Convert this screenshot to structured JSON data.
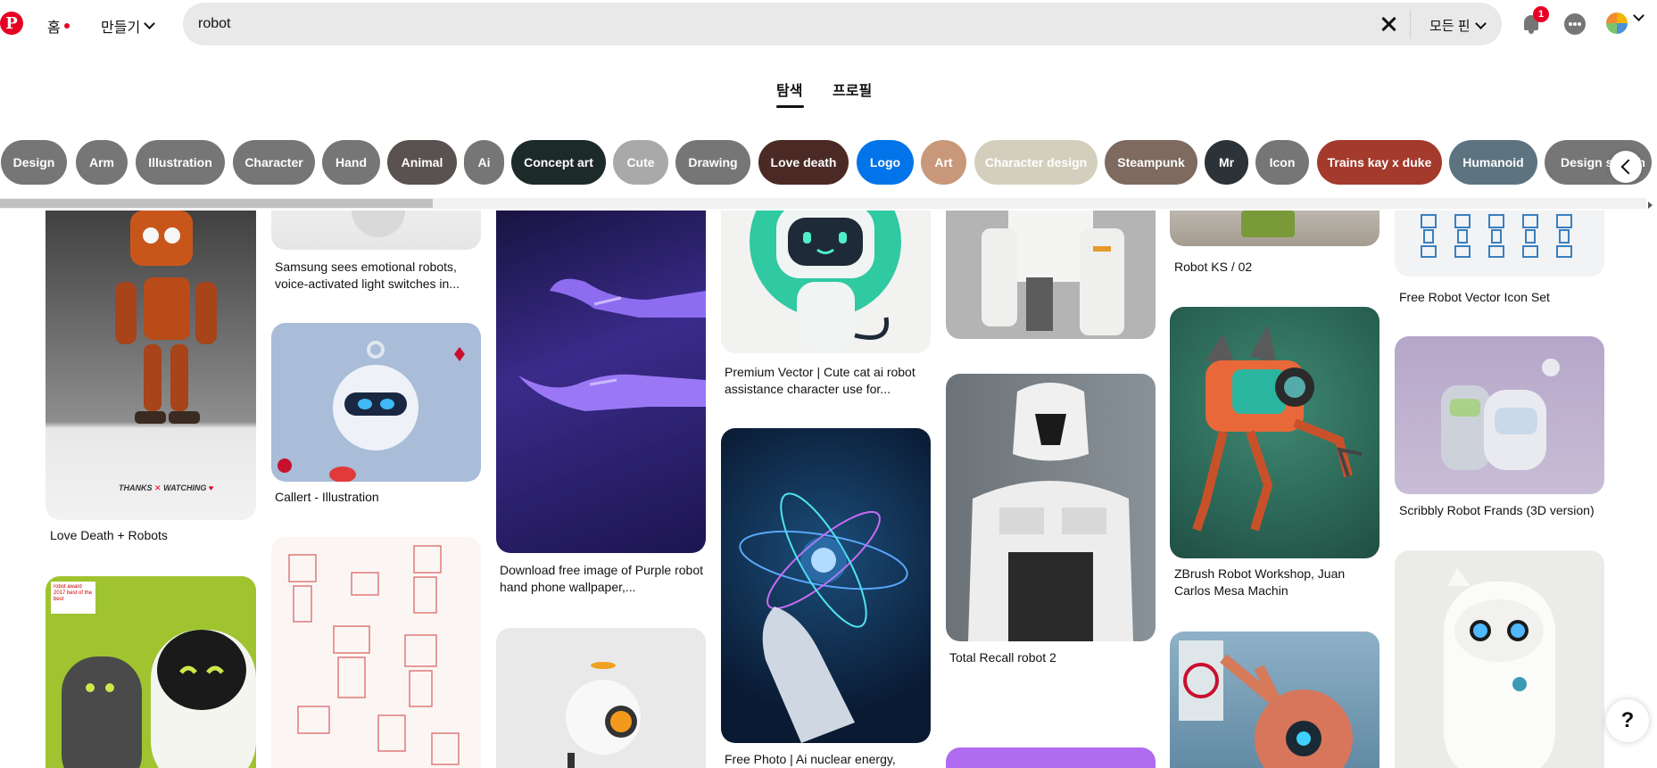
{
  "nav": {
    "home": "홈",
    "create": "만들기"
  },
  "search": {
    "value": "robot",
    "filter": "모든 핀"
  },
  "notifications": {
    "count": "1"
  },
  "tabs": [
    "탐색",
    "프로필"
  ],
  "chips": [
    {
      "label": "Design",
      "color": "#767676"
    },
    {
      "label": "Arm",
      "color": "#767676"
    },
    {
      "label": "Illustration",
      "color": "#767676"
    },
    {
      "label": "Character",
      "color": "#767676"
    },
    {
      "label": "Hand",
      "color": "#767676"
    },
    {
      "label": "Animal",
      "color": "#5a5250"
    },
    {
      "label": "Ai",
      "color": "#767676"
    },
    {
      "label": "Concept art",
      "color": "#1d2a2a"
    },
    {
      "label": "Cute",
      "color": "#a9a9a9"
    },
    {
      "label": "Drawing",
      "color": "#767676"
    },
    {
      "label": "Love death",
      "color": "#4b2a25"
    },
    {
      "label": "Logo",
      "color": "#0074e8"
    },
    {
      "label": "Art",
      "color": "#c9977a"
    },
    {
      "label": "Character design",
      "color": "#d4cfbd"
    },
    {
      "label": "Steampunk",
      "color": "#7e6a5e"
    },
    {
      "label": "Mr",
      "color": "#2b3238"
    },
    {
      "label": "Icon",
      "color": "#767676"
    },
    {
      "label": "Trains kay x duke",
      "color": "#a33a2c"
    },
    {
      "label": "Humanoid",
      "color": "#5d7380"
    },
    {
      "label": "Design sketch",
      "color": "#767676"
    }
  ],
  "captions": {
    "c1a": "Love Death + Robots",
    "c2a": "Samsung sees emotional robots, voice-activated light switches in...",
    "c2b": "Callert - Illustration",
    "c3a": "Download free image of Purple robot hand phone wallpaper,...",
    "c4a": "Premium Vector | Cute cat ai robot assistance character use for...",
    "c4b": "Free Photo | Ai nuclear energy,",
    "c5a": "Total Recall robot 2",
    "c6a": "Robot KS / 02",
    "c6b": "ZBrush Robot Workshop, Juan Carlos Mesa Machin",
    "c7a": "Free Robot Vector Icon Set",
    "c7b": "Scribbly Robot Frands (3D version)"
  },
  "pin_text": {
    "thanks": "THANKS",
    "watching": "WATCHING",
    "award": "robot award 2017 best of the best"
  },
  "help": "?"
}
